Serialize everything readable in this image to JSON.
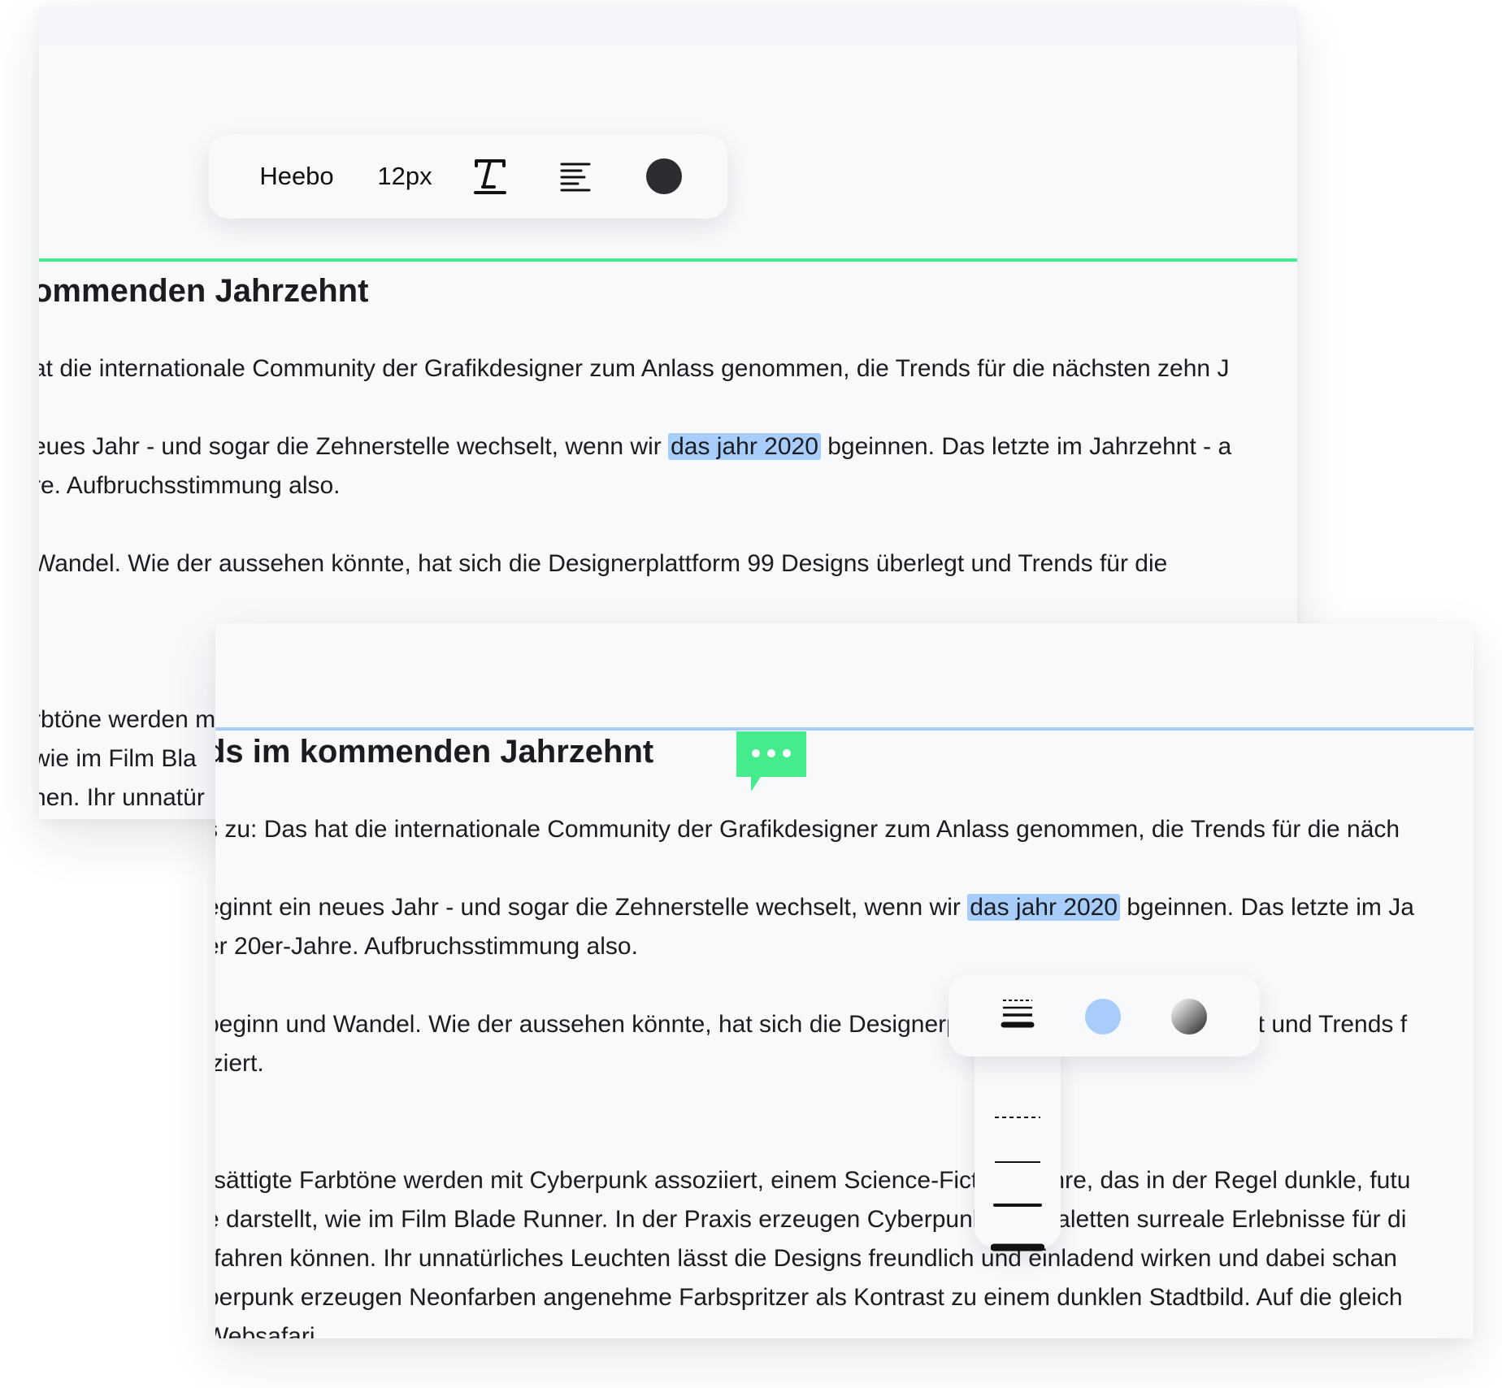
{
  "toolbar": {
    "font_name": "Heebo",
    "font_size": "12px",
    "style_icon": "text-style-icon",
    "align_icon": "align-left-icon",
    "color_icon": "color-dot-icon",
    "color": "#2b2d31"
  },
  "back_doc": {
    "heading": "ommenden Jahrzehnt",
    "p1": "at die internationale Community der Grafikdesigner zum Anlass genommen, die Trends für die nächsten zehn J",
    "p2_pre": "eues Jahr - und sogar die Zehnerstelle wechselt, wenn wir ",
    "p2_hl": "das jahr 2020",
    "p2_post": " bgeinnen. Das letzte im Jahrzehnt - a",
    "p2_l2": "re. Aufbruchsstimmung also.",
    "p3": "Wandel. Wie der aussehen könnte, hat sich die Designerplattform 99 Designs überlegt und Trends für die",
    "p4_l1": "rbtöne werden m",
    "p4_l2": "wie im Film Bla",
    "p4_l3": "nen. Ihr unnatür"
  },
  "front_doc": {
    "heading": "ds im kommenden Jahrzehnt",
    "p1": "s zu: Das hat die internationale Community der Grafikdesigner zum Anlass genommen, die Trends für die näch",
    "p2_pre": "eginnt ein neues Jahr - und sogar die Zehnerstelle wechselt, wenn wir ",
    "p2_hl": "das jahr 2020",
    "p2_post": " bgeinnen. Das letzte im Ja",
    "p2_l2": "er 20er-Jahre. Aufbruchsstimmung also.",
    "p3_l1": "beginn und Wandel. Wie der aussehen könnte, hat sich die Designerplattform 99 Designs überlegt und Trends f",
    "p3_l2": "iziert.",
    "p4_l1": "rsättigte Farbtöne werden mit Cyberpunk assoziiert, einem Science-Fiction-Genre, das in der Regel dunkle, futu",
    "p4_l2": "e darstellt, wie im Film Blade Runner. In der Praxis erzeugen Cyberpunk-Farbpaletten surreale Erlebnisse für di",
    "p4_l3": "rfahren können. Ihr unnatürliches Leuchten lässt die Designs freundlich und einladend wirken und dabei schan",
    "p4_l4": "berpunk erzeugen Neonfarben angenehme Farbspritzer als Kontrast zu einem dunklen Stadtbild. Auf die gleich",
    "p4_l5": "                                                Websafari"
  },
  "comment": {
    "icon": "comment-bubble-icon",
    "color": "#44ec8c"
  },
  "line_popup": {
    "icons": [
      "line-weight-icon",
      "blue-color-swatch-icon",
      "gradient-swatch-icon"
    ],
    "swatch_color": "#a8cdfb",
    "options": [
      "dashed-line-option",
      "thin-line-option",
      "medium-line-option",
      "thick-line-option"
    ]
  },
  "colors": {
    "accent_green": "#44ec8c",
    "accent_blue": "#a8cdfb",
    "highlight": "#a8cdfb",
    "panel_bg": "#f8f9fb"
  }
}
